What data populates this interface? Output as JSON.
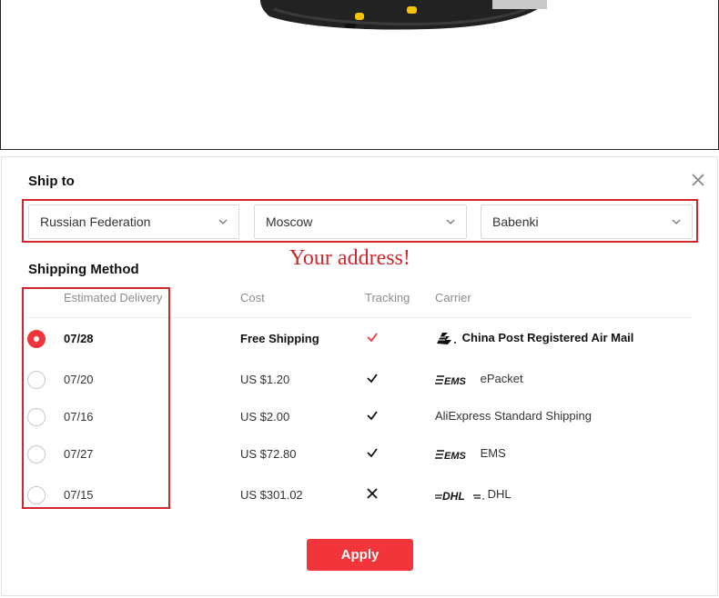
{
  "colors": {
    "accent": "#f2353b",
    "highlight": "#d2262d",
    "annotation": "#d2262d"
  },
  "dialog": {
    "ship_to_title": "Ship to",
    "close_icon": "close-icon",
    "address": {
      "country": "Russian Federation",
      "city": "Moscow",
      "district": "Babenki"
    },
    "annotation": "Your address!",
    "shipping_title": "Shipping Method",
    "columns": {
      "delivery": "Estimated Delivery",
      "cost": "Cost",
      "tracking": "Tracking",
      "carrier": "Carrier"
    },
    "options": [
      {
        "date": "07/28",
        "cost": "Free Shipping",
        "tracking": "check",
        "logo": "china-post-logo",
        "carrier": "China Post Registered Air Mail",
        "selected": true
      },
      {
        "date": "07/20",
        "cost": "US $1.20",
        "tracking": "check",
        "logo": "ems-logo",
        "carrier": "ePacket",
        "selected": false
      },
      {
        "date": "07/16",
        "cost": "US $2.00",
        "tracking": "check",
        "logo": "",
        "carrier": "AliExpress Standard Shipping",
        "selected": false
      },
      {
        "date": "07/27",
        "cost": "US $72.80",
        "tracking": "check",
        "logo": "ems-logo",
        "carrier": "EMS",
        "selected": false
      },
      {
        "date": "07/15",
        "cost": "US $301.02",
        "tracking": "cross",
        "logo": "dhl-logo",
        "carrier": "DHL",
        "selected": false
      }
    ],
    "apply_label": "Apply"
  }
}
